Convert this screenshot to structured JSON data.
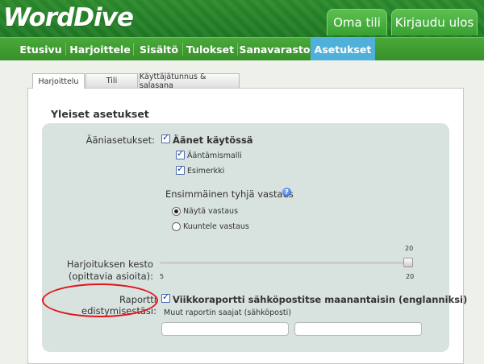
{
  "header": {
    "logo": "WordDive",
    "account_button": "Oma tili",
    "logout_button": "Kirjaudu ulos"
  },
  "nav": {
    "items": [
      "Etusivu",
      "Harjoittele",
      "Sisältö",
      "Tulokset",
      "Sanavarasto",
      "Asetukset"
    ],
    "active": "Asetukset",
    "active_color": "#4fb0d9"
  },
  "tabs": {
    "items": [
      "Harjoittelu",
      "Tili",
      "Käyttäjätunnus & salasana"
    ],
    "active": "Harjoittelu"
  },
  "section": {
    "title": "Yleiset asetukset"
  },
  "sound": {
    "label": "Ääniasetukset:",
    "enabled_label": "Äänet käytössä",
    "pronunciation_label": "Ääntämismalli",
    "example_label": "Esimerkki"
  },
  "first_empty": {
    "title": "Ensimmäinen tyhjä vastaus",
    "options": [
      "Näytä vastaus",
      "Kuuntele vastaus"
    ],
    "selected": "Näytä vastaus"
  },
  "duration": {
    "label_line1": "Harjoituksen kesto",
    "label_line2": "(opittavia asioita):",
    "min": "5",
    "max": "20",
    "current": "20"
  },
  "report": {
    "label": "Raportti edistymisestäsi:",
    "weekly_label": "Viikkoraportti sähköpostitse maanantaisin (englanniksi)",
    "other_recipients_label": "Muut raportin saajat (sähköposti)",
    "recipient1": "",
    "recipient2": ""
  },
  "colors": {
    "header_green": "#2c8a2c",
    "nav_green": "#4aa93a",
    "annotation_red": "#e3141a"
  }
}
